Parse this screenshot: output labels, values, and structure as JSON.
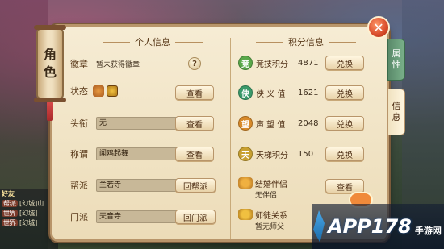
{
  "role_tab": {
    "char1": "角",
    "char2": "色"
  },
  "personal": {
    "title": "个人信息",
    "badge_label": "徽章",
    "badge_value": "暂未获得徽章",
    "help": "?",
    "status_label": "状态",
    "status_button": "查看",
    "title_label": "头衔",
    "title_value": "无",
    "title_button": "查看",
    "nickname_label": "称谓",
    "nickname_value": "闻鸡起舞",
    "nickname_button": "查看",
    "guild_label": "帮派",
    "guild_value": "兰若寺",
    "guild_button": "回帮派",
    "sect_label": "门派",
    "sect_value": "天音寺",
    "sect_button": "回门派"
  },
  "points": {
    "title": "积分信息",
    "items": [
      {
        "icon_char": "竞",
        "name": "竞技积分",
        "value": "4871",
        "button": "兑换",
        "color": "#5aa84a"
      },
      {
        "icon_char": "侠",
        "name": "侠 义 值",
        "value": "1621",
        "button": "兑换",
        "color": "#3a9a6a"
      },
      {
        "icon_char": "望",
        "name": "声 望 值",
        "value": "2048",
        "button": "兑换",
        "color": "#d88a2a"
      },
      {
        "icon_char": "天",
        "name": "天梯积分",
        "value": "150",
        "button": "兑换",
        "color": "#c8a030"
      }
    ],
    "marriage_title": "结婚伴侣",
    "marriage_value": "无伴侣",
    "marriage_button": "查看",
    "master_title": "师徒关系",
    "master_value": "暂无师父"
  },
  "side_tabs": {
    "attr_1": "属",
    "attr_2": "性",
    "info_1": "信",
    "info_2": "息"
  },
  "close": "✕",
  "chat": {
    "lines": [
      {
        "tag": "帮派",
        "text": "[幻城]山"
      },
      {
        "tag": "世界",
        "text": "[幻城]"
      },
      {
        "tag": "世界",
        "text": "[幻城]"
      }
    ],
    "top_label": "好友"
  },
  "watermark": {
    "main": "APP178",
    "sub": "手游网"
  }
}
